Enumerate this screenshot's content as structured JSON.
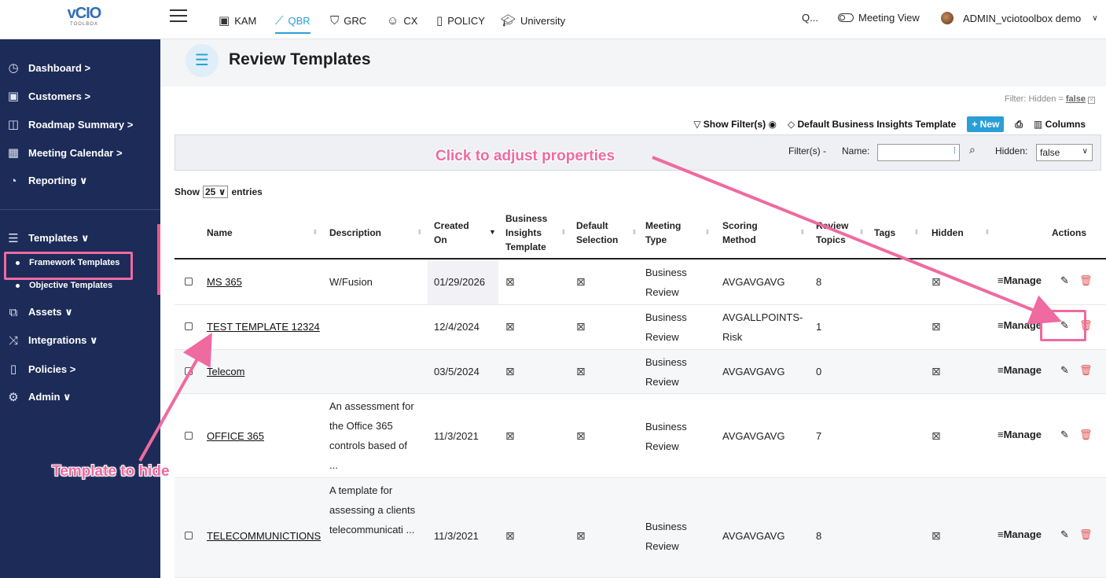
{
  "logo": {
    "line1": "vCIO",
    "line2": "TOOLBOX"
  },
  "topnav": {
    "items": [
      {
        "label": "KAM",
        "icon": "id-card-icon"
      },
      {
        "label": "QBR",
        "icon": "chart-line-icon"
      },
      {
        "label": "GRC",
        "icon": "shield-icon"
      },
      {
        "label": "CX",
        "icon": "smiley-icon"
      },
      {
        "label": "POLICY",
        "icon": "document-icon"
      },
      {
        "label": "University",
        "icon": "graduation-cap-icon"
      }
    ],
    "search": "Q...",
    "meeting_view": "Meeting View",
    "user": "ADMIN_vciotoolbox demo"
  },
  "sidebar": {
    "items": [
      {
        "label": "Dashboard >",
        "icon": "dashboard-icon"
      },
      {
        "label": "Customers >",
        "icon": "customers-icon"
      },
      {
        "label": "Roadmap Summary >",
        "icon": "map-icon"
      },
      {
        "label": "Meeting Calendar >",
        "icon": "calendar-icon"
      },
      {
        "label": "Reporting ∨",
        "icon": "pie-chart-icon"
      },
      {
        "label": "Templates ∨",
        "icon": "templates-icon"
      },
      {
        "label": "Assets ∨",
        "icon": "assets-icon"
      },
      {
        "label": "Integrations ∨",
        "icon": "shuffle-icon"
      },
      {
        "label": "Policies >",
        "icon": "policies-icon"
      },
      {
        "label": "Admin ∨",
        "icon": "gears-icon"
      }
    ],
    "sub_items": [
      "Framework Templates",
      "Objective Templates"
    ]
  },
  "page": {
    "title": "Review Templates",
    "filter_hint_prefix": "Filter: Hidden = ",
    "filter_hint_value": "false",
    "toolbar": {
      "show_filters": "Show Filter(s)",
      "default_bi": "Default Business Insights Template",
      "new": "+ New",
      "columns": "Columns"
    },
    "filterbar": {
      "filters_label": "Filter(s) -",
      "name_label": "Name:",
      "hidden_label": "Hidden:",
      "hidden_value": "false"
    },
    "show_prefix": "Show",
    "show_value": "25",
    "show_suffix": "entries"
  },
  "table": {
    "headers": [
      "Name",
      "Description",
      "Created On",
      "Business Insights Template",
      "Default Selection",
      "Meeting Type",
      "Scoring Method",
      "Review Topics",
      "Tags",
      "Hidden",
      "Actions"
    ],
    "rows": [
      {
        "name": "MS 365",
        "desc": "W/Fusion",
        "created": "01/29/2026",
        "meeting": "Business Review",
        "scoring": "AVGAVGAVG",
        "topics": "8"
      },
      {
        "name": "TEST TEMPLATE 12324",
        "desc": "",
        "created": "12/4/2024",
        "meeting": "Business Review",
        "scoring": "AVGALLPOINTS-Risk",
        "topics": "1"
      },
      {
        "name": "Telecom",
        "desc": "",
        "created": "03/5/2024",
        "meeting": "Business Review",
        "scoring": "AVGAVGAVG",
        "topics": "0"
      },
      {
        "name": "OFFICE 365",
        "desc": "An assessment for the Office 365 controls based of ...",
        "created": "11/3/2021",
        "meeting": "Business Review",
        "scoring": "AVGAVGAVG",
        "topics": "7"
      },
      {
        "name": "TELECOMMUNICTIONS",
        "desc": "A template for assessing a clients telecommunicati ...",
        "created": "11/3/2021",
        "meeting": "Business Review",
        "scoring": "AVGAVGAVG",
        "topics": "8"
      }
    ],
    "manage_label": "≡Manage"
  },
  "annotations": {
    "click_adjust": "Click to adjust properties",
    "template_hide": "Template to hide"
  },
  "colors": {
    "sidebar": "#1c2b57",
    "accent": "#2a9fd6",
    "annotation": "#ef6aa0",
    "delete": "#e05353"
  }
}
